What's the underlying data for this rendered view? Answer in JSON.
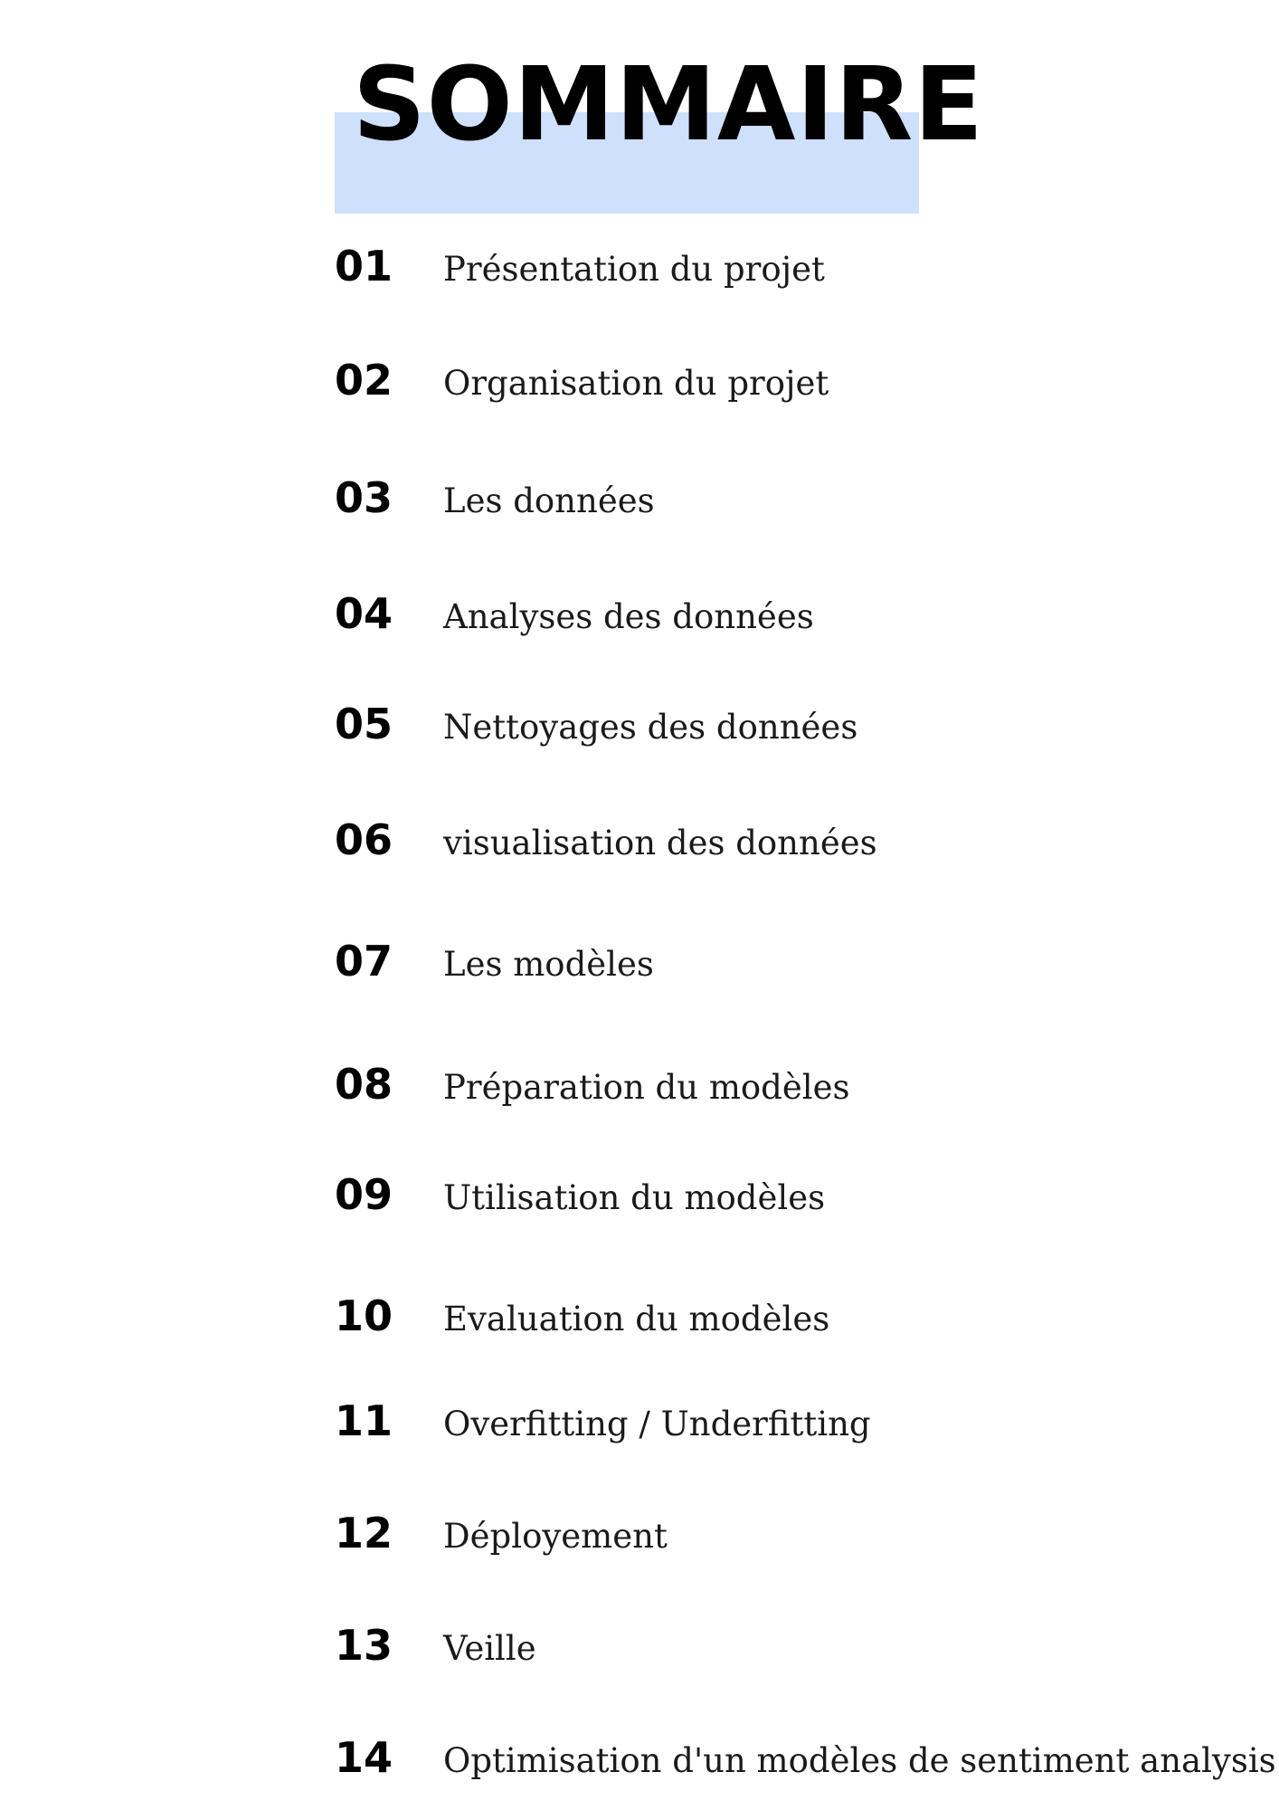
{
  "title": "SOMMAIRE",
  "colors": {
    "title_highlight": "#cfe0fc"
  },
  "items": [
    {
      "number": "01",
      "label": "Présentation du projet"
    },
    {
      "number": "02",
      "label": "Organisation du projet"
    },
    {
      "number": "03",
      "label": "Les données"
    },
    {
      "number": "04",
      "label": "Analyses des données"
    },
    {
      "number": "05",
      "label": "Nettoyages des données"
    },
    {
      "number": "06",
      "label": "visualisation des données"
    },
    {
      "number": "07",
      "label": "Les modèles"
    },
    {
      "number": "08",
      "label": "Préparation du modèles"
    },
    {
      "number": "09",
      "label": "Utilisation du modèles"
    },
    {
      "number": "10",
      "label": "Evaluation du modèles"
    },
    {
      "number": "11",
      "label": "Overfitting / Underfitting"
    },
    {
      "number": "12",
      "label": "Déployement"
    },
    {
      "number": "13",
      "label": "Veille"
    },
    {
      "number": "14",
      "label": "Optimisation d'un modèles de sentiment analysis"
    }
  ]
}
